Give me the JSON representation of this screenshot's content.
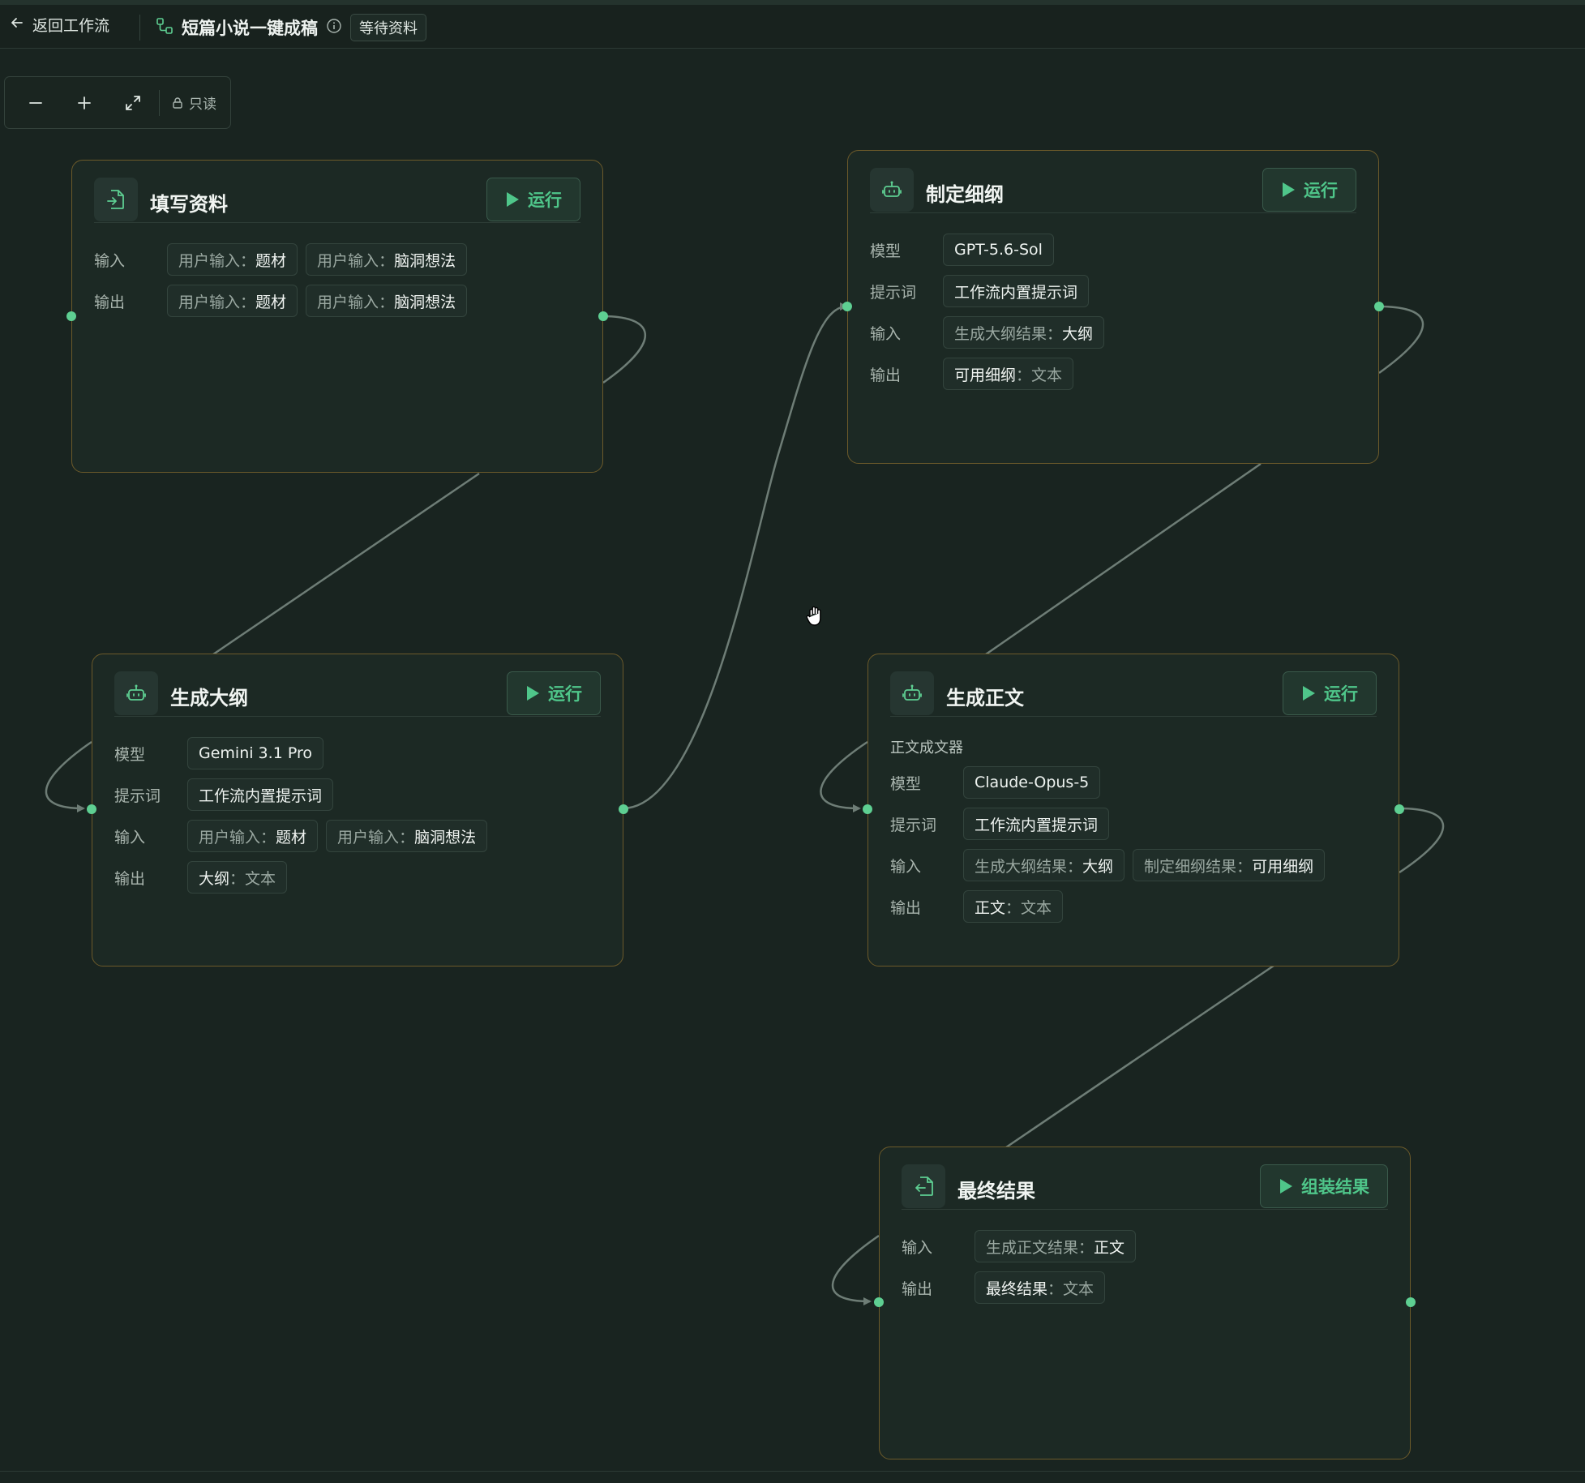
{
  "header": {
    "back_label": "返回工作流",
    "workflow_title": "短篇小说一键成稿",
    "status": "等待资料"
  },
  "toolbar": {
    "readonly_label": "只读"
  },
  "nodes": {
    "fill": {
      "title": "填写资料",
      "run_label": "运行",
      "input_label": "输入",
      "output_label": "输出",
      "inputs": [
        {
          "key": "用户输入",
          "value": "题材"
        },
        {
          "key": "用户输入",
          "value": "脑洞想法"
        }
      ],
      "outputs": [
        {
          "key": "用户输入",
          "value": "题材"
        },
        {
          "key": "用户输入",
          "value": "脑洞想法"
        }
      ]
    },
    "outline": {
      "title": "生成大纲",
      "run_label": "运行",
      "model_label": "模型",
      "model": "Gemini 3.1 Pro",
      "prompt_label": "提示词",
      "prompt": "工作流内置提示词",
      "input_label": "输入",
      "output_label": "输出",
      "inputs": [
        {
          "key": "用户输入",
          "value": "题材"
        },
        {
          "key": "用户输入",
          "value": "脑洞想法"
        }
      ],
      "output": {
        "name": "大纲",
        "type": "文本"
      }
    },
    "detail": {
      "title": "制定细纲",
      "run_label": "运行",
      "model_label": "模型",
      "model": "GPT-5.6-Sol",
      "prompt_label": "提示词",
      "prompt": "工作流内置提示词",
      "input_label": "输入",
      "output_label": "输出",
      "input": {
        "key": "生成大纲结果",
        "value": "大纲"
      },
      "output": {
        "name": "可用细纲",
        "type": "文本"
      }
    },
    "body": {
      "title": "生成正文",
      "run_label": "运行",
      "subtitle": "正文成文器",
      "model_label": "模型",
      "model": "Claude-Opus-5",
      "prompt_label": "提示词",
      "prompt": "工作流内置提示词",
      "input_label": "输入",
      "output_label": "输出",
      "inputs": [
        {
          "key": "生成大纲结果",
          "value": "大纲"
        },
        {
          "key": "制定细纲结果",
          "value": "可用细纲"
        }
      ],
      "output": {
        "name": "正文",
        "type": "文本"
      }
    },
    "final": {
      "title": "最终结果",
      "run_label": "组装结果",
      "input_label": "输入",
      "output_label": "输出",
      "input": {
        "key": "生成正文结果",
        "value": "正文"
      },
      "output": {
        "name": "最终结果",
        "type": "文本"
      }
    }
  },
  "icons": {
    "back": "arrow-left-icon",
    "workflow": "workflow-icon",
    "info": "info-icon",
    "zoom_out": "minus-icon",
    "zoom_in": "plus-icon",
    "fit": "expand-icon",
    "lock": "lock-icon",
    "run": "play-icon",
    "input_node": "file-import-icon",
    "ai_node": "robot-icon",
    "output_node": "file-export-icon",
    "cursor": "hand-grab-icon"
  },
  "colors": {
    "background": "#192420",
    "node_border": "#6c5a2a",
    "accent": "#4fc68a",
    "port": "#5ecf92",
    "edge": "#6e7d76"
  }
}
